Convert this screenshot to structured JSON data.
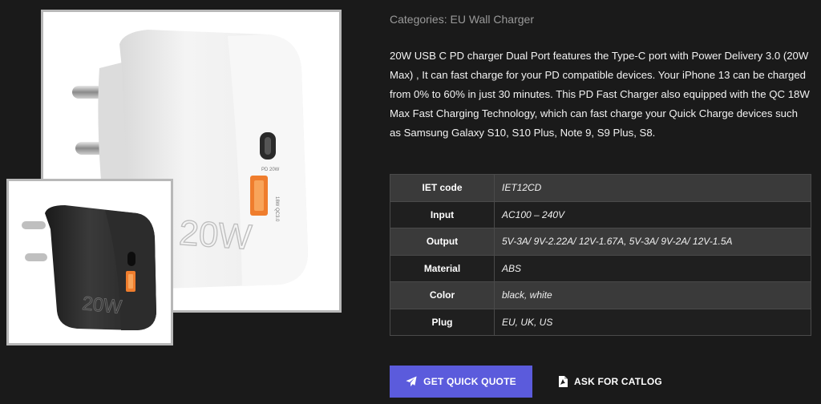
{
  "product": {
    "categories_prefix": "Categories:",
    "category": "EU Wall Charger",
    "description": "20W USB C PD charger Dual Port features the Type-C port with Power Delivery 3.0 (20W Max) , It can fast charge for your PD compatible devices. Your iPhone 13 can be charged from 0% to 60% in just 30 minutes. This PD Fast Charger also equipped with the QC 18W Max Fast Charging Technology, which can fast charge your Quick Charge devices such as Samsung Galaxy S10, S10 Plus, Note 9, S9 Plus, S8."
  },
  "images": {
    "main_label_big": "20W",
    "main_label_pd": "PD 20W",
    "main_label_qc": "18W QC3.0",
    "thumb_label_big": "20W"
  },
  "specs": [
    {
      "key": "IET code",
      "value": "IET12CD"
    },
    {
      "key": "Input",
      "value": "AC100 – 240V"
    },
    {
      "key": "Output",
      "value": "5V-3A/ 9V-2.22A/ 12V-1.67A, 5V-3A/ 9V-2A/ 12V-1.5A"
    },
    {
      "key": "Material",
      "value": "ABS"
    },
    {
      "key": "Color",
      "value": "black, white"
    },
    {
      "key": "Plug",
      "value": "EU, UK, US"
    }
  ],
  "actions": {
    "quote_label": "GET QUICK QUOTE",
    "quote_icon": "paper-plane-icon",
    "catalog_label": "ASK FOR CATLOG",
    "catalog_icon": "pdf-file-icon"
  },
  "colors": {
    "background": "#1a1a1a",
    "accent": "#5b5bdc"
  }
}
